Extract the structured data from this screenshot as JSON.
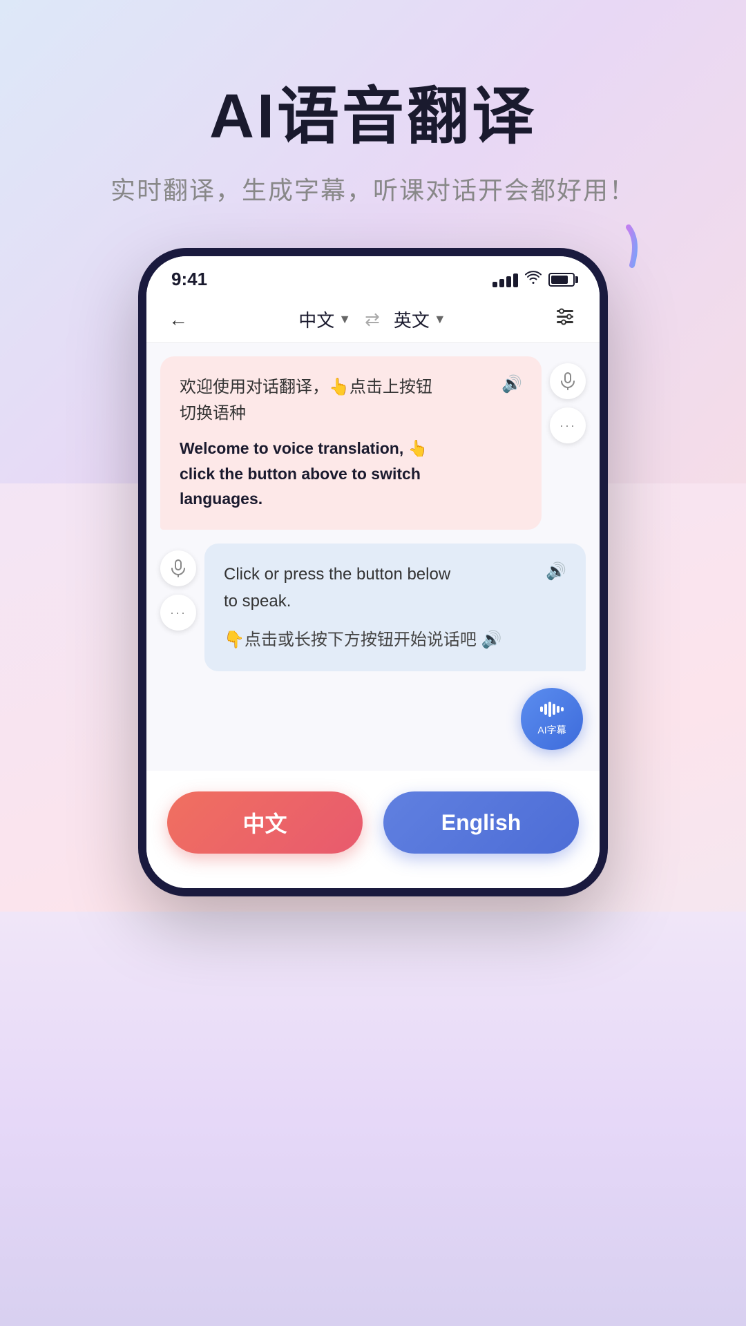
{
  "header": {
    "title": "AI语音翻译",
    "subtitle": "实时翻译，生成字幕，听课对话开会都好用！"
  },
  "status_bar": {
    "time": "9:41"
  },
  "toolbar": {
    "source_lang": "中文",
    "target_lang": "英文",
    "back_label": "←"
  },
  "bubble_left": {
    "text1": "欢迎使用对话翻译，👆点击上按钮切换语种",
    "text2": "Welcome to voice translation, 👆 click the button above to switch languages."
  },
  "bubble_right": {
    "text1": "Click or press the button below to speak.",
    "text2": "👇点击或长按下方按钮开始说话吧"
  },
  "ai_subtitle_btn": {
    "label": "AI字幕"
  },
  "bottom_btns": {
    "chinese": "中文",
    "english": "English"
  },
  "action_btns": {
    "mic": "🎤",
    "more": "···",
    "mic2": "🎤",
    "more2": "···"
  }
}
